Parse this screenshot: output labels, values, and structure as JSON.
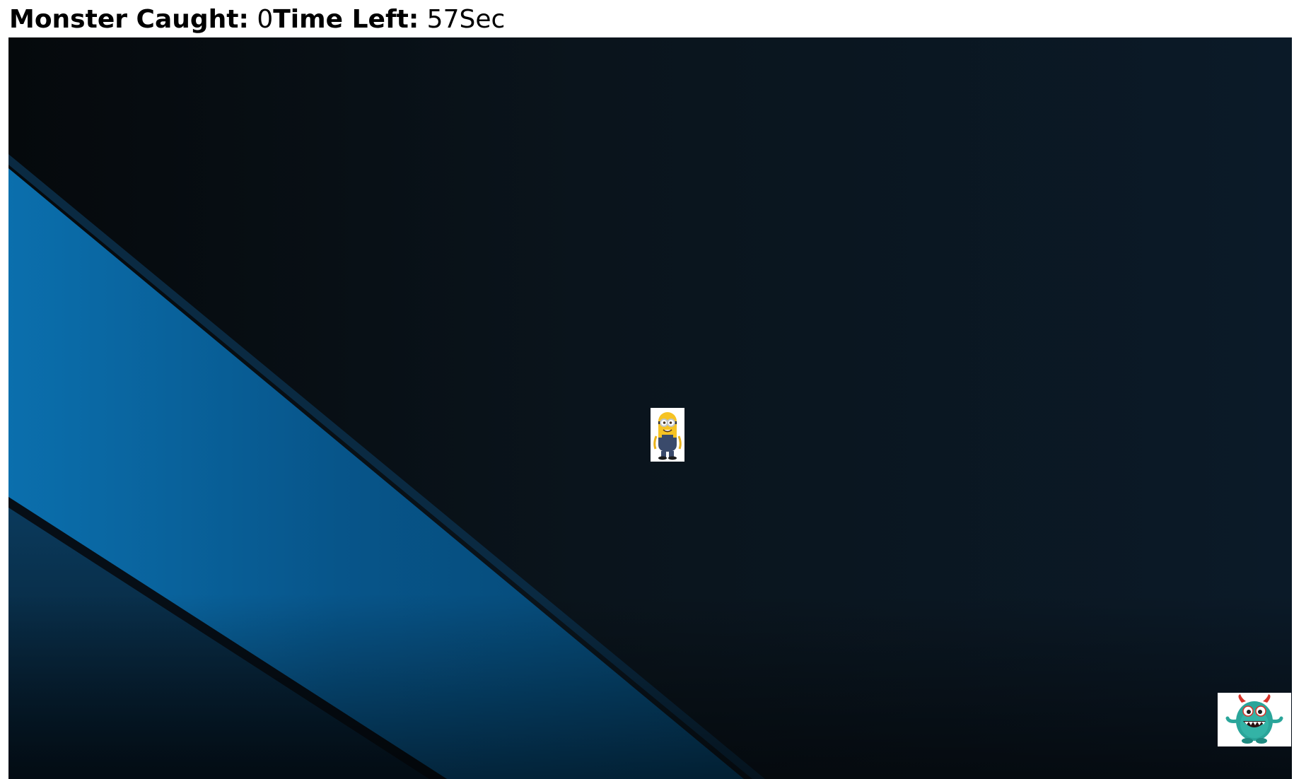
{
  "hud": {
    "caught_label": "Monster Caught:",
    "caught_value": "0",
    "time_label": "Time Left:",
    "time_value": "57",
    "time_unit": "Sec"
  },
  "sprites": {
    "hero": {
      "icon": "minion-character-icon"
    },
    "monster": {
      "icon": "teal-monster-icon"
    }
  },
  "colors": {
    "background_dark": "#05090c",
    "background_navy": "#0b1a28",
    "stripe_blue": "#0b6aa8",
    "stripe_dark_blue": "#093c60",
    "hero_yellow": "#f6c324",
    "hero_overalls": "#3a4a6b",
    "monster_teal": "#2aa59a",
    "monster_horns": "#d8342b"
  }
}
